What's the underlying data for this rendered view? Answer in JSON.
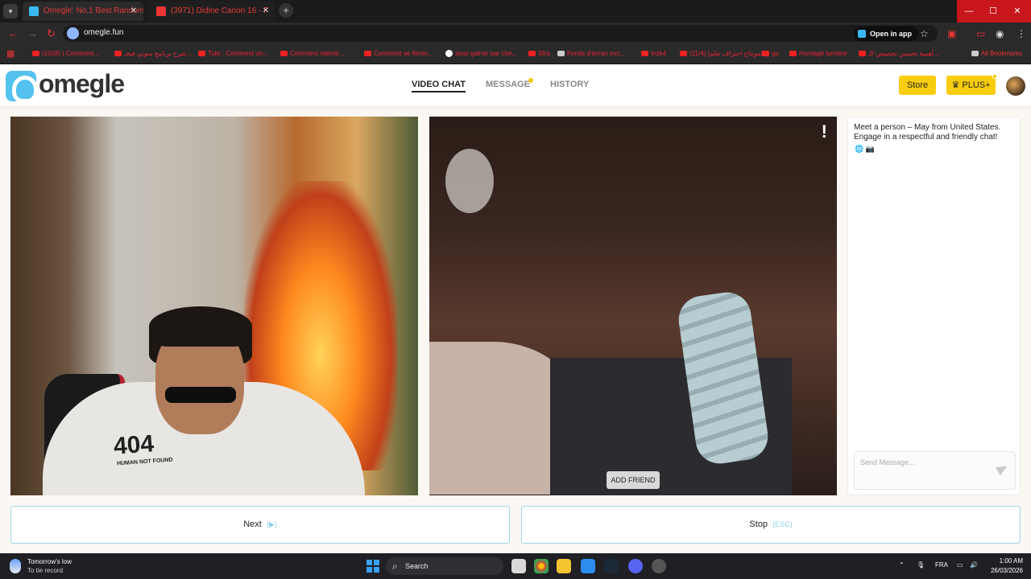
{
  "browser": {
    "tabs": [
      {
        "title": "Omegle: No.1 Best Random",
        "active": true
      },
      {
        "title": "(3971) Didine Canon 16 - F",
        "active": false
      }
    ],
    "url": "omegle.fun",
    "open_in_app": "Open in app",
    "bookmarks": [
      {
        "label": "(1018) | Comment...",
        "icon": "youtube-icon"
      },
      {
        "label": "شرح برنامج سوني فيجـ...",
        "icon": "youtube-icon"
      },
      {
        "label": "Tuto : Comment un...",
        "icon": "youtube-icon"
      },
      {
        "label": "Comment ralentir...",
        "icon": "youtube-icon"
      },
      {
        "label": "Comment se filmer...",
        "icon": "youtube-icon"
      },
      {
        "label": "sous gainer par che...",
        "icon": "google-icon"
      },
      {
        "label": "Stra",
        "icon": "youtube-icon"
      },
      {
        "label": "Fonds d'écran incr...",
        "icon": "custom-icon"
      },
      {
        "label": "tnzk4",
        "icon": "youtube-icon"
      },
      {
        "label": "(11/4) |المونتاج احتراف تعلم",
        "icon": "youtube-icon"
      },
      {
        "label": "go",
        "icon": "youtube-icon"
      },
      {
        "label": "montage lumière",
        "icon": "youtube-icon"
      },
      {
        "label": "أهمية تحسين تخصيص الـ...",
        "icon": "youtube-icon"
      }
    ],
    "all_bookmarks": "All Bookmarks"
  },
  "header": {
    "logo_text": "omegle",
    "nav": [
      {
        "label": "VIDEO CHAT",
        "active": true
      },
      {
        "label": "MESSAGE",
        "active": false
      },
      {
        "label": "HISTORY",
        "active": false
      }
    ],
    "store_label": "Store",
    "plus_label": "♛ PLUS+"
  },
  "videos": {
    "hoodie_text": "404",
    "hoodie_subtext": "HUMAN NOT FOUND",
    "report_label": "!",
    "add_friend_label": "ADD FRIEND"
  },
  "chat": {
    "intro": "Meet a person – May from United States. Engage in a respectful and friendly chat!",
    "flags": "🌐 📷",
    "placeholder": "Send Message..."
  },
  "actions": {
    "next_label": "Next",
    "next_hint": "(▶)",
    "stop_label": "Stop",
    "stop_hint": "(ESC)"
  },
  "taskbar": {
    "weather_title": "Tomorrow's low",
    "weather_sub": "To tie record",
    "search_label": "Search",
    "lang": "FRA",
    "time": "1:00 AM",
    "date": "26/03/2026"
  },
  "colors": {
    "accent_yellow": "#f8cd0e",
    "accent_blue": "#54c2ee",
    "close_red": "#c8161c"
  }
}
